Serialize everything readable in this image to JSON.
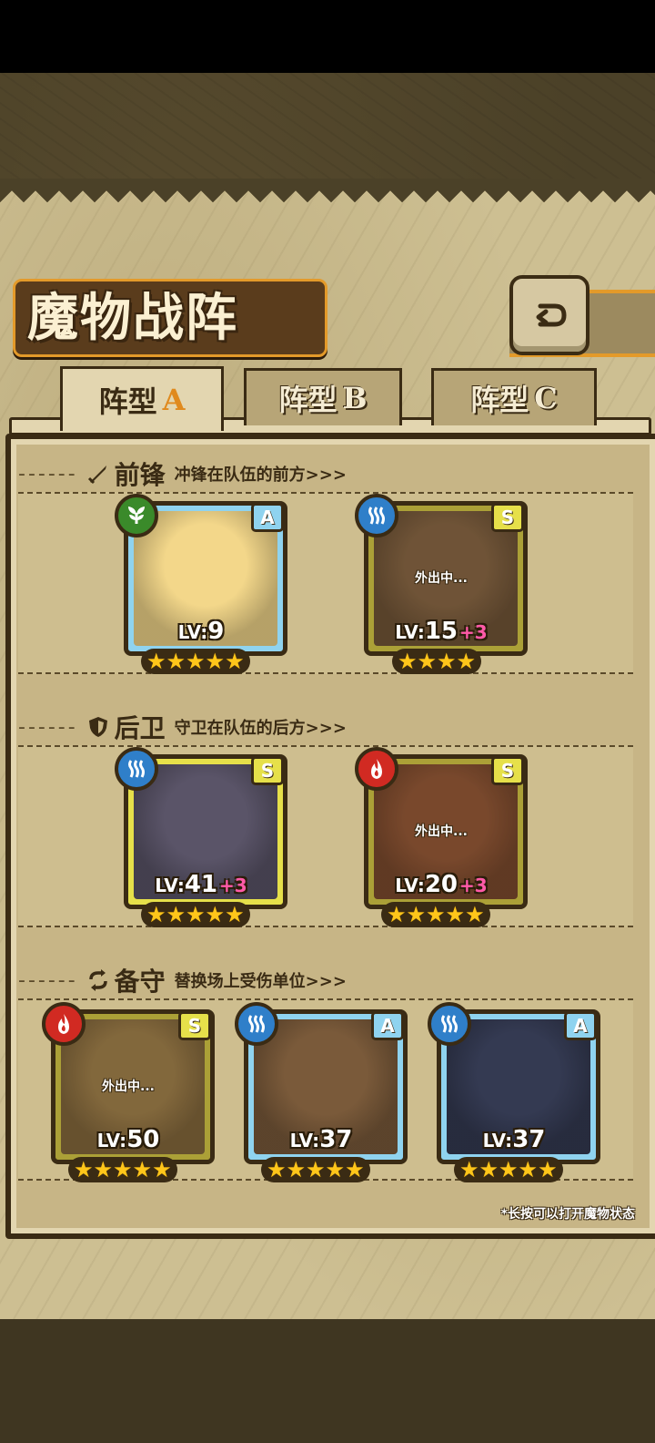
{
  "screen": {
    "title": "魔物战阵",
    "back_icon": "back-arrow-icon"
  },
  "tabs": [
    {
      "label": "阵型",
      "suffix": "A",
      "active": true
    },
    {
      "label": "阵型",
      "suffix": "B",
      "active": false
    },
    {
      "label": "阵型",
      "suffix": "C",
      "active": false
    }
  ],
  "sections": {
    "vanguard": {
      "icon": "sword-icon",
      "name": "前锋",
      "desc": "冲锋在队伍的前方>>>"
    },
    "rearguard": {
      "icon": "shield-icon",
      "name": "后卫",
      "desc": "守卫在队伍的后方>>>"
    },
    "reserve": {
      "icon": "swap-icon",
      "name": "备守",
      "desc": "替换场上受伤单位>>>"
    }
  },
  "lv_prefix": "LV:",
  "away_text": "外出中...",
  "cards": {
    "vanguard": [
      {
        "element": "wood",
        "element_icon": "leaf-icon",
        "rarity": "A",
        "level": "9",
        "plus": "",
        "stars": 5,
        "away": false,
        "portrait": "#f3d78a"
      },
      {
        "element": "water",
        "element_icon": "water-wave-icon",
        "rarity": "S",
        "level": "15",
        "plus": "+3",
        "stars": 4,
        "away": true,
        "portrait": "#8a6b4a"
      }
    ],
    "rearguard": [
      {
        "element": "water",
        "element_icon": "water-wave-icon",
        "rarity": "S",
        "level": "41",
        "plus": "+3",
        "stars": 5,
        "away": false,
        "portrait": "#5a5468"
      },
      {
        "element": "fire",
        "element_icon": "flame-icon",
        "rarity": "S",
        "level": "20",
        "plus": "+3",
        "stars": 5,
        "away": true,
        "portrait": "#9a5a3a"
      }
    ],
    "reserve": [
      {
        "element": "fire",
        "element_icon": "flame-icon",
        "rarity": "S",
        "level": "50",
        "plus": "",
        "stars": 5,
        "away": true,
        "portrait": "#a88a52"
      },
      {
        "element": "water",
        "element_icon": "water-wave-icon",
        "rarity": "A",
        "level": "37",
        "plus": "",
        "stars": 5,
        "away": false,
        "portrait": "#7a5a3a"
      },
      {
        "element": "water",
        "element_icon": "water-wave-icon",
        "rarity": "A",
        "level": "37",
        "plus": "",
        "stars": 5,
        "away": false,
        "portrait": "#343a52"
      }
    ]
  },
  "hint": "*长按可以打开魔物状态"
}
